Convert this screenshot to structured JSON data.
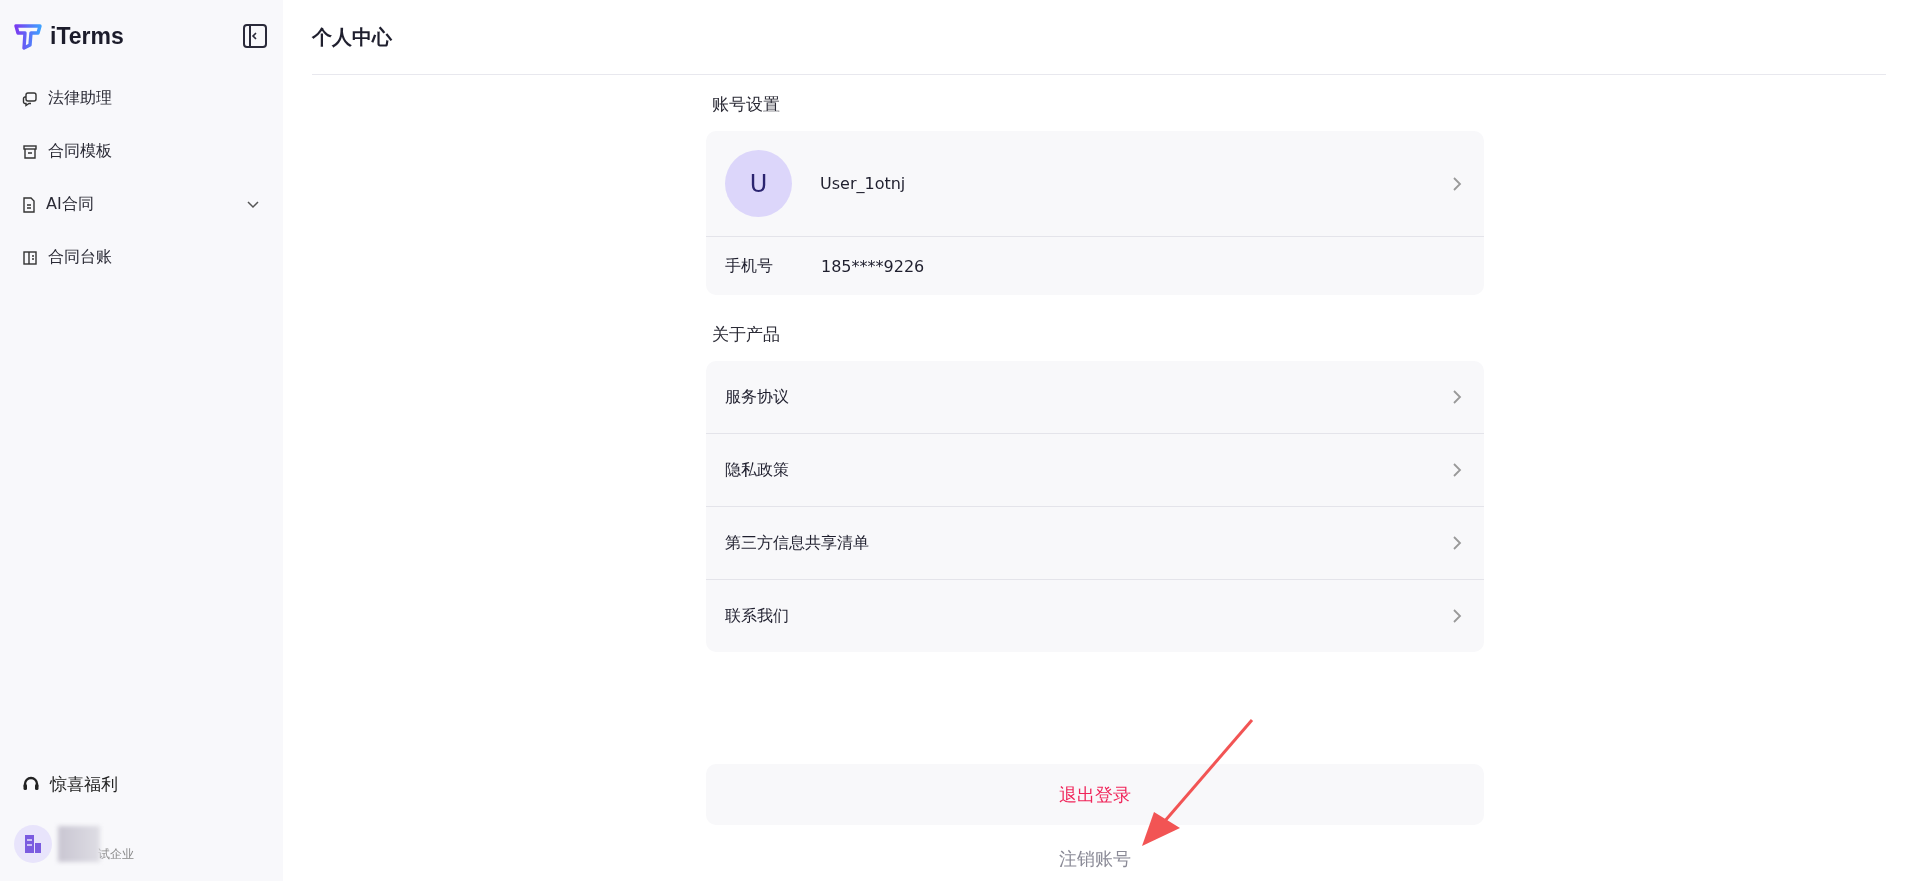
{
  "sidebar": {
    "logo": "iTerms",
    "items": [
      {
        "label": "法律助理",
        "kind": "chat",
        "expandable": false,
        "selected": false
      },
      {
        "label": "合同模板",
        "kind": "archive",
        "expandable": false,
        "selected": false
      },
      {
        "label": "AI合同",
        "kind": "doc",
        "expandable": true,
        "selected": false
      },
      {
        "label": "合同台账",
        "kind": "ledger",
        "expandable": false,
        "selected": false
      }
    ],
    "bonus": "惊喜福利",
    "org": "试企业"
  },
  "page": {
    "title": "个人中心"
  },
  "account": {
    "heading": "账号设置",
    "avatar": "U",
    "username": "User_1otnj",
    "phone_label": "手机号",
    "phone": "185****9226"
  },
  "about": {
    "heading": "关于产品",
    "items": [
      "服务协议",
      "隐私政策",
      "第三方信息共享清单",
      "联系我们"
    ]
  },
  "logout": "退出登录",
  "deactivate": "注销账号"
}
